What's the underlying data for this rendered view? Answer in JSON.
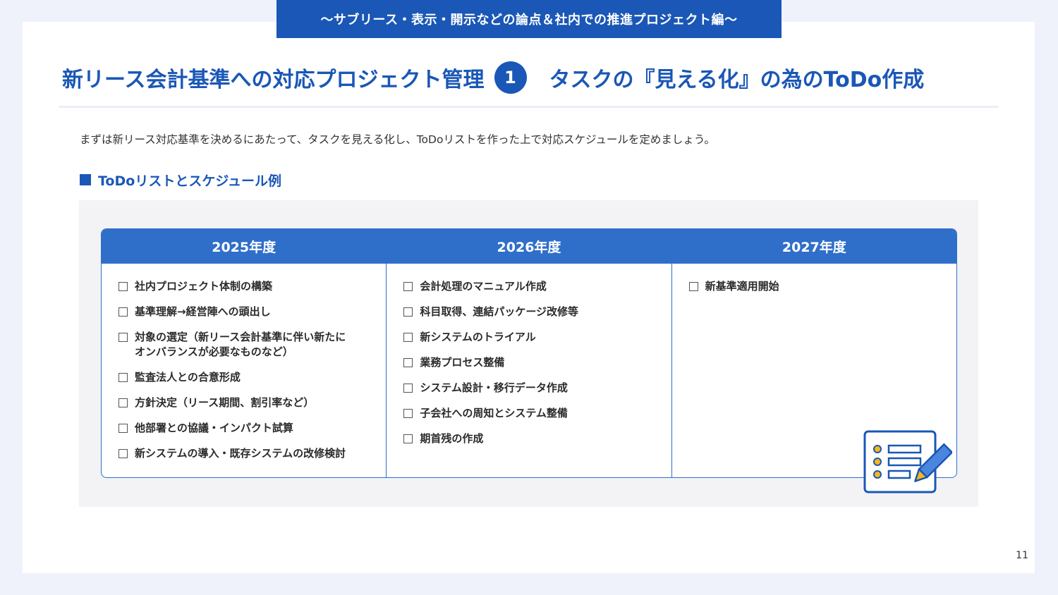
{
  "header": {
    "tab_label": "〜サブリース・表示・開示などの論点＆社内での推進プロジェクト編〜",
    "title_main": "新リース会計基準への対応プロジェクト管理",
    "title_number": "1",
    "title_sub": "タスクの『見える化』の為のToDo作成"
  },
  "intro_text": "まずは新リース対応基準を決めるにあたって、タスクを見える化し、ToDoリストを作った上で対応スケジュールを定めましょう。",
  "section": {
    "heading": "ToDoリストとスケジュール例"
  },
  "schedule": {
    "columns": [
      {
        "year": "2025年度",
        "items": [
          "社内プロジェクト体制の構築",
          "基準理解→経営陣への頭出し",
          "対象の選定（新リース会計基準に伴い新たに\nオンバランスが必要なものなど）",
          "監査法人との合意形成",
          "方針決定（リース期間、割引率など）",
          "他部署との協議・インパクト試算",
          "新システムの導入・既存システムの改修検討"
        ]
      },
      {
        "year": "2026年度",
        "items": [
          "会計処理のマニュアル作成",
          "科目取得、連結パッケージ改修等",
          "新システムのトライアル",
          "業務プロセス整備",
          "システム設計・移行データ作成",
          "子会社への周知とシステム整備",
          "期首残の作成"
        ]
      },
      {
        "year": "2027年度",
        "items": [
          "新基準適用開始"
        ]
      }
    ]
  },
  "illustration": {
    "icon": "todo-checklist-pencil-icon"
  },
  "page_number": "11",
  "colors": {
    "primary": "#1a57b6",
    "table_header": "#2f6fca",
    "icon_yellow": "#f5b71a",
    "panel_grey": "#f3f3f5",
    "background": "#eff2fb"
  }
}
